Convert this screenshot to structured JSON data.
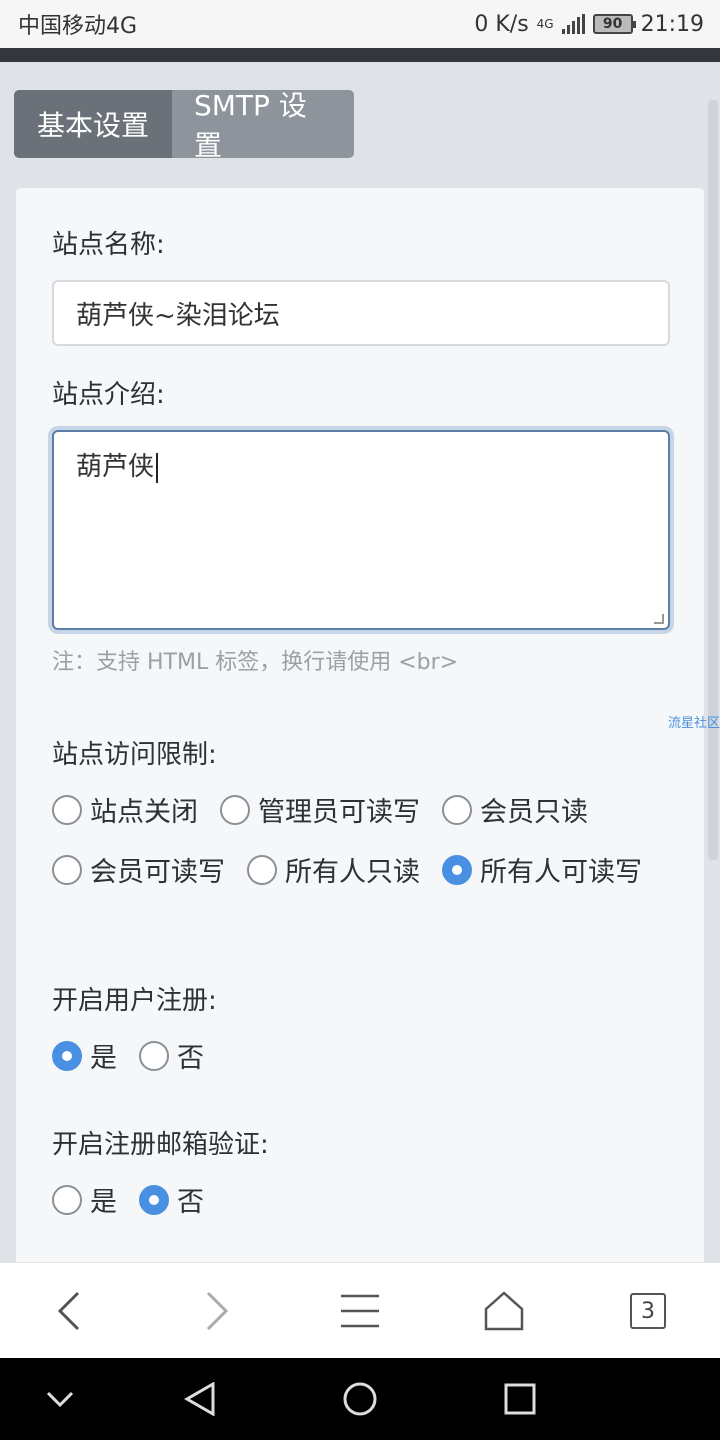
{
  "status_bar": {
    "carrier": "中国移动4G",
    "net_speed": "0 K/s",
    "network": "4G",
    "battery": "90",
    "time": "21:19"
  },
  "tabs": [
    {
      "label": "基本设置",
      "active": true
    },
    {
      "label": "SMTP 设置",
      "active": false
    }
  ],
  "form": {
    "site_name_label": "站点名称:",
    "site_name_value": "葫芦侠~染泪论坛",
    "site_intro_label": "站点介绍:",
    "site_intro_value": "葫芦侠",
    "site_intro_hint": "注：支持 HTML 标签，换行请使用 <br>",
    "watermark": "流星社区",
    "access_label": "站点访问限制:",
    "access_options": [
      {
        "label": "站点关闭",
        "checked": false
      },
      {
        "label": "管理员可读写",
        "checked": false
      },
      {
        "label": "会员只读",
        "checked": false
      },
      {
        "label": "会员可读写",
        "checked": false
      },
      {
        "label": "所有人只读",
        "checked": false
      },
      {
        "label": "所有人可读写",
        "checked": true
      }
    ],
    "register_label": "开启用户注册:",
    "register_options": [
      {
        "label": "是",
        "checked": true
      },
      {
        "label": "否",
        "checked": false
      }
    ],
    "email_verify_label": "开启注册邮箱验证:",
    "email_verify_options": [
      {
        "label": "是",
        "checked": false
      },
      {
        "label": "否",
        "checked": true
      }
    ]
  },
  "browser_nav": {
    "tab_count": "3",
    "icons": [
      "back-icon",
      "forward-icon",
      "menu-icon",
      "home-icon",
      "tabs-icon"
    ]
  },
  "system_nav": {
    "icons": [
      "collapse-icon",
      "back-triangle-icon",
      "home-circle-icon",
      "recents-square-icon"
    ]
  },
  "colors": {
    "accent": "#4a90e2",
    "tab_active": "#6b7178",
    "tab_inactive": "#8e949b",
    "hint": "#9aa0a6"
  }
}
